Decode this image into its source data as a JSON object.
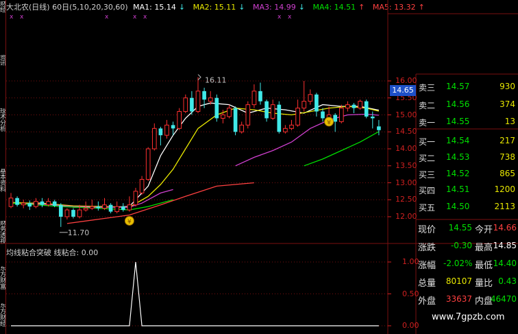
{
  "left_tabs": [
    "财经",
    "资讯",
    "技术分析",
    "基本资料",
    "财务透视",
    "东方财富",
    "东方财经"
  ],
  "header": {
    "title": "大北农(日线) 60日(5,10,20,30,60)",
    "ma": [
      {
        "label": "MA1: 15.14",
        "arrow": "↓",
        "color": "#ffffff"
      },
      {
        "label": "MA2: 15.11",
        "arrow": "↓",
        "color": "#e8e800"
      },
      {
        "label": "MA3: 14.99",
        "arrow": "↓",
        "color": "#d040d0"
      },
      {
        "label": "MA4: 14.51",
        "arrow": "↑",
        "color": "#00e000"
      },
      {
        "label": "MA5: 13.32",
        "arrow": "↑",
        "color": "#ff4040"
      }
    ],
    "marker_glyph": "x"
  },
  "price_axis": [
    "16.00",
    "15.50",
    "15.00",
    "14.50",
    "14.00",
    "13.50",
    "13.00",
    "12.50",
    "12.00"
  ],
  "current_price_tag": "14.65",
  "annotations": {
    "high_label": "16.11",
    "low_label": "11.70",
    "coin_glyph": "¥"
  },
  "indicator": {
    "title": "均线粘合突破 线粘合: 0.00",
    "axis": [
      "1.00",
      "0.50",
      "0.00"
    ]
  },
  "order_book": {
    "asks": [
      {
        "label": "卖三",
        "price": "14.57",
        "volume": "930"
      },
      {
        "label": "卖二",
        "price": "14.56",
        "volume": "374"
      },
      {
        "label": "卖一",
        "price": "14.55",
        "volume": "13"
      }
    ],
    "bids": [
      {
        "label": "买一",
        "price": "14.54",
        "volume": "217"
      },
      {
        "label": "买二",
        "price": "14.53",
        "volume": "738"
      },
      {
        "label": "买三",
        "price": "14.52",
        "volume": "865"
      },
      {
        "label": "买四",
        "price": "14.51",
        "volume": "1200"
      },
      {
        "label": "买五",
        "price": "14.50",
        "volume": "2113"
      }
    ]
  },
  "stats": [
    {
      "l1": "现价",
      "v1": "14.55",
      "c1": "#00e000",
      "l2": "今开",
      "v2": "14.66",
      "c2": "#ff4040"
    },
    {
      "l1": "涨跌",
      "v1": "-0.30",
      "c1": "#00e000",
      "l2": "最高",
      "v2": "14.85",
      "c2": "#ffffff"
    },
    {
      "l1": "涨幅",
      "v1": "-2.02%",
      "c1": "#00e000",
      "l2": "最低",
      "v2": "14.40",
      "c2": "#00e000"
    },
    {
      "l1": "总量",
      "v1": "80107",
      "c1": "#e8e800",
      "l2": "量比",
      "v2": "0.43",
      "c2": "#00e000"
    },
    {
      "l1": "外盘",
      "v1": "33637",
      "c1": "#ff4040",
      "l2": "内盘",
      "v2": "46470",
      "c2": "#00e000"
    }
  ],
  "watermark": "www.7gpzb.com",
  "colors": {
    "up": "#ff3030",
    "down": "#40e8e8",
    "grid": "#7a1010"
  },
  "chart_data": {
    "type": "candlestick",
    "ylim": [
      11.7,
      16.11
    ],
    "candles": [
      {
        "o": 12.3,
        "c": 12.55,
        "h": 12.7,
        "l": 12.25
      },
      {
        "o": 12.55,
        "c": 12.35,
        "h": 12.6,
        "l": 12.3
      },
      {
        "o": 12.35,
        "c": 12.4,
        "h": 12.5,
        "l": 12.25
      },
      {
        "o": 12.4,
        "c": 12.3,
        "h": 12.48,
        "l": 12.2
      },
      {
        "o": 12.3,
        "c": 12.45,
        "h": 12.55,
        "l": 12.25
      },
      {
        "o": 12.45,
        "c": 12.35,
        "h": 12.55,
        "l": 12.28
      },
      {
        "o": 12.35,
        "c": 12.45,
        "h": 12.55,
        "l": 12.3
      },
      {
        "o": 12.45,
        "c": 12.32,
        "h": 12.5,
        "l": 12.28
      },
      {
        "o": 12.35,
        "c": 12.0,
        "h": 12.4,
        "l": 11.7
      },
      {
        "o": 12.0,
        "c": 12.2,
        "h": 12.25,
        "l": 11.92
      },
      {
        "o": 12.2,
        "c": 12.0,
        "h": 12.25,
        "l": 11.95
      },
      {
        "o": 12.0,
        "c": 12.2,
        "h": 12.35,
        "l": 11.95
      },
      {
        "o": 12.2,
        "c": 12.25,
        "h": 12.45,
        "l": 12.15
      },
      {
        "o": 12.25,
        "c": 12.3,
        "h": 12.5,
        "l": 12.2
      },
      {
        "o": 12.3,
        "c": 12.25,
        "h": 12.45,
        "l": 12.18
      },
      {
        "o": 12.25,
        "c": 12.35,
        "h": 12.55,
        "l": 12.2
      },
      {
        "o": 12.35,
        "c": 12.15,
        "h": 12.4,
        "l": 12.1
      },
      {
        "o": 12.15,
        "c": 12.3,
        "h": 12.45,
        "l": 12.1
      },
      {
        "o": 12.3,
        "c": 12.2,
        "h": 12.4,
        "l": 12.15
      },
      {
        "o": 12.2,
        "c": 12.35,
        "h": 12.6,
        "l": 12.15
      },
      {
        "o": 12.35,
        "c": 12.75,
        "h": 12.85,
        "l": 12.3
      },
      {
        "o": 12.7,
        "c": 13.1,
        "h": 13.2,
        "l": 12.65
      },
      {
        "o": 13.1,
        "c": 14.0,
        "h": 14.05,
        "l": 13.05
      },
      {
        "o": 14.0,
        "c": 14.6,
        "h": 14.75,
        "l": 13.95
      },
      {
        "o": 14.6,
        "c": 14.4,
        "h": 14.65,
        "l": 14.1
      },
      {
        "o": 14.4,
        "c": 14.7,
        "h": 14.85,
        "l": 14.3
      },
      {
        "o": 14.7,
        "c": 14.6,
        "h": 14.8,
        "l": 14.4
      },
      {
        "o": 14.6,
        "c": 15.1,
        "h": 15.2,
        "l": 14.55
      },
      {
        "o": 15.1,
        "c": 15.5,
        "h": 15.6,
        "l": 15.05
      },
      {
        "o": 15.5,
        "c": 15.1,
        "h": 15.7,
        "l": 15.0
      },
      {
        "o": 15.1,
        "c": 15.7,
        "h": 16.11,
        "l": 15.05
      },
      {
        "o": 15.7,
        "c": 15.45,
        "h": 15.8,
        "l": 15.2
      },
      {
        "o": 15.4,
        "c": 15.5,
        "h": 15.7,
        "l": 15.3
      },
      {
        "o": 15.5,
        "c": 14.9,
        "h": 15.6,
        "l": 14.8
      },
      {
        "o": 14.9,
        "c": 15.0,
        "h": 15.15,
        "l": 14.75
      },
      {
        "o": 14.95,
        "c": 15.2,
        "h": 15.3,
        "l": 14.9
      },
      {
        "o": 15.2,
        "c": 14.5,
        "h": 15.25,
        "l": 14.4
      },
      {
        "o": 14.5,
        "c": 14.7,
        "h": 14.8,
        "l": 14.45
      },
      {
        "o": 14.7,
        "c": 15.3,
        "h": 15.4,
        "l": 14.6
      },
      {
        "o": 15.3,
        "c": 15.7,
        "h": 15.9,
        "l": 15.2
      },
      {
        "o": 15.7,
        "c": 15.4,
        "h": 15.95,
        "l": 15.3
      },
      {
        "o": 15.4,
        "c": 14.9,
        "h": 15.45,
        "l": 14.8
      },
      {
        "o": 14.9,
        "c": 15.3,
        "h": 15.45,
        "l": 14.85
      },
      {
        "o": 15.3,
        "c": 14.5,
        "h": 15.4,
        "l": 14.45
      },
      {
        "o": 14.5,
        "c": 14.6,
        "h": 14.7,
        "l": 14.45
      },
      {
        "o": 14.6,
        "c": 14.7,
        "h": 14.85,
        "l": 14.55
      },
      {
        "o": 14.7,
        "c": 15.2,
        "h": 15.45,
        "l": 14.65
      },
      {
        "o": 15.2,
        "c": 15.4,
        "h": 16.0,
        "l": 15.1
      },
      {
        "o": 15.4,
        "c": 15.6,
        "h": 15.75,
        "l": 15.3
      },
      {
        "o": 15.6,
        "c": 15.1,
        "h": 15.65,
        "l": 14.95
      },
      {
        "o": 15.1,
        "c": 14.9,
        "h": 15.2,
        "l": 14.8
      },
      {
        "o": 14.9,
        "c": 15.0,
        "h": 15.25,
        "l": 14.85
      },
      {
        "o": 15.0,
        "c": 14.8,
        "h": 15.05,
        "l": 14.5
      },
      {
        "o": 14.8,
        "c": 15.2,
        "h": 15.3,
        "l": 14.75
      },
      {
        "o": 15.2,
        "c": 15.3,
        "h": 15.4,
        "l": 15.1
      },
      {
        "o": 15.3,
        "c": 15.2,
        "h": 15.35,
        "l": 15.05
      },
      {
        "o": 15.2,
        "c": 15.4,
        "h": 15.45,
        "l": 15.15
      },
      {
        "o": 15.4,
        "c": 14.95,
        "h": 15.45,
        "l": 14.9
      },
      {
        "o": 14.95,
        "c": 14.9,
        "h": 15.1,
        "l": 14.6
      },
      {
        "o": 14.66,
        "c": 14.55,
        "h": 14.85,
        "l": 14.4
      }
    ],
    "ma_lines": [
      {
        "name": "MA1",
        "color": "#ffffff",
        "points": [
          [
            0,
            12.4
          ],
          [
            5,
            12.4
          ],
          [
            10,
            12.28
          ],
          [
            15,
            12.28
          ],
          [
            19,
            12.3
          ],
          [
            22,
            12.9
          ],
          [
            24,
            13.8
          ],
          [
            26,
            14.4
          ],
          [
            28,
            14.9
          ],
          [
            30,
            15.25
          ],
          [
            32,
            15.35
          ],
          [
            35,
            15.3
          ],
          [
            38,
            15.05
          ],
          [
            41,
            15.2
          ],
          [
            44,
            15.15
          ],
          [
            47,
            15.05
          ],
          [
            50,
            15.3
          ],
          [
            53,
            15.25
          ],
          [
            56,
            15.25
          ],
          [
            59,
            15.14
          ]
        ]
      },
      {
        "name": "MA2",
        "color": "#e8e800",
        "points": [
          [
            0,
            12.42
          ],
          [
            6,
            12.38
          ],
          [
            10,
            12.32
          ],
          [
            15,
            12.3
          ],
          [
            19,
            12.28
          ],
          [
            22,
            12.6
          ],
          [
            24,
            12.95
          ],
          [
            26,
            13.4
          ],
          [
            28,
            14.0
          ],
          [
            30,
            14.6
          ],
          [
            33,
            15.0
          ],
          [
            36,
            15.2
          ],
          [
            39,
            15.15
          ],
          [
            42,
            15.05
          ],
          [
            45,
            15.0
          ],
          [
            48,
            15.1
          ],
          [
            51,
            15.2
          ],
          [
            54,
            15.25
          ],
          [
            57,
            15.2
          ],
          [
            59,
            15.11
          ]
        ]
      },
      {
        "name": "MA3",
        "color": "#d040d0",
        "points": [
          [
            0,
            12.4
          ],
          [
            6,
            12.36
          ],
          [
            10,
            12.3
          ],
          [
            15,
            12.28
          ],
          [
            19,
            12.28
          ],
          [
            21,
            12.4
          ],
          [
            24,
            12.7
          ],
          [
            26,
            12.8
          ]
        ]
      },
      {
        "name": "MA3b",
        "color": "#d040d0",
        "points": [
          [
            36,
            13.5
          ],
          [
            39,
            13.75
          ],
          [
            42,
            13.95
          ],
          [
            45,
            14.2
          ],
          [
            48,
            14.6
          ],
          [
            51,
            14.85
          ],
          [
            54,
            15.0
          ],
          [
            57,
            15.02
          ],
          [
            59,
            14.99
          ]
        ]
      },
      {
        "name": "MA4",
        "color": "#00e000",
        "points": [
          [
            0,
            12.4
          ],
          [
            8,
            12.3
          ],
          [
            14,
            12.25
          ],
          [
            19,
            12.2
          ],
          [
            22,
            12.3
          ],
          [
            26,
            12.5
          ]
        ]
      },
      {
        "name": "MA4b",
        "color": "#00e000",
        "points": [
          [
            47,
            13.5
          ],
          [
            50,
            13.7
          ],
          [
            53,
            13.95
          ],
          [
            56,
            14.2
          ],
          [
            59,
            14.51
          ]
        ]
      },
      {
        "name": "MA5",
        "color": "#ff4040",
        "points": [
          [
            9,
            11.8
          ],
          [
            15,
            11.95
          ],
          [
            19,
            12.05
          ],
          [
            24,
            12.35
          ],
          [
            28,
            12.6
          ],
          [
            33,
            12.9
          ],
          [
            39,
            13.0
          ]
        ]
      }
    ],
    "indicator_series": {
      "x": [
        0,
        19,
        20,
        21,
        59
      ],
      "y": [
        0,
        0,
        1,
        0,
        0
      ]
    }
  }
}
